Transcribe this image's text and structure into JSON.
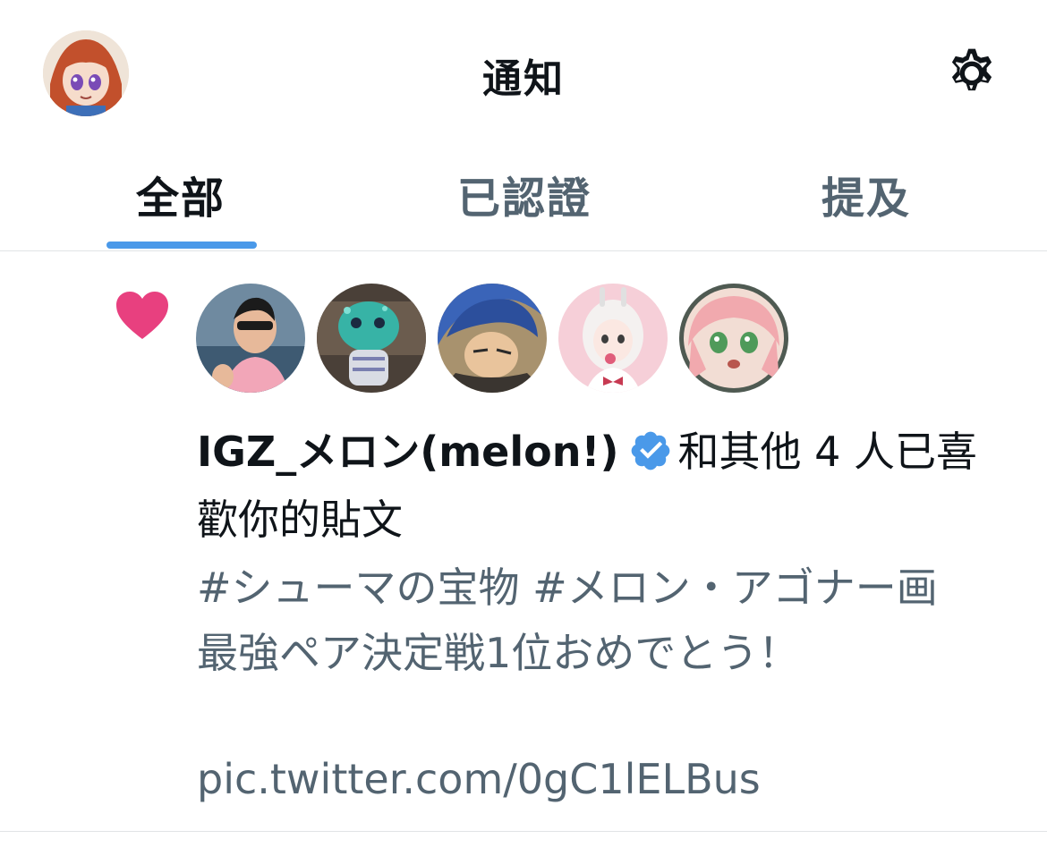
{
  "header": {
    "title": "通知",
    "avatar_icon": "user-avatar-anime-girl",
    "settings_icon": "gear-icon"
  },
  "tabs": [
    {
      "label": "全部",
      "active": true
    },
    {
      "label": "已認證",
      "active": false
    },
    {
      "label": "提及",
      "active": false
    }
  ],
  "colors": {
    "accent": "#4a99e9",
    "like_heart": "#e8407f",
    "verified": "#4a99e9",
    "secondary_text": "#536471"
  },
  "notification": {
    "type_icon": "heart-icon",
    "likers": [
      {
        "avatar": "man-sunglasses-avatar"
      },
      {
        "avatar": "jellyfish-character-avatar"
      },
      {
        "avatar": "blue-hair-anime-avatar"
      },
      {
        "avatar": "white-hair-girl-avatar"
      },
      {
        "avatar": "pink-hair-girl-avatar"
      }
    ],
    "user_name": "IGZ_メロン(melon!)",
    "verified_icon": "verified-badge-icon",
    "action_text": "和其他 4 人已喜歡你的貼文",
    "post_text": "#シューマの宝物 #メロン・アゴナー画\n最強ペア決定戦1位おめでとう！",
    "post_link": "pic.twitter.com/0gC1lELBus"
  }
}
